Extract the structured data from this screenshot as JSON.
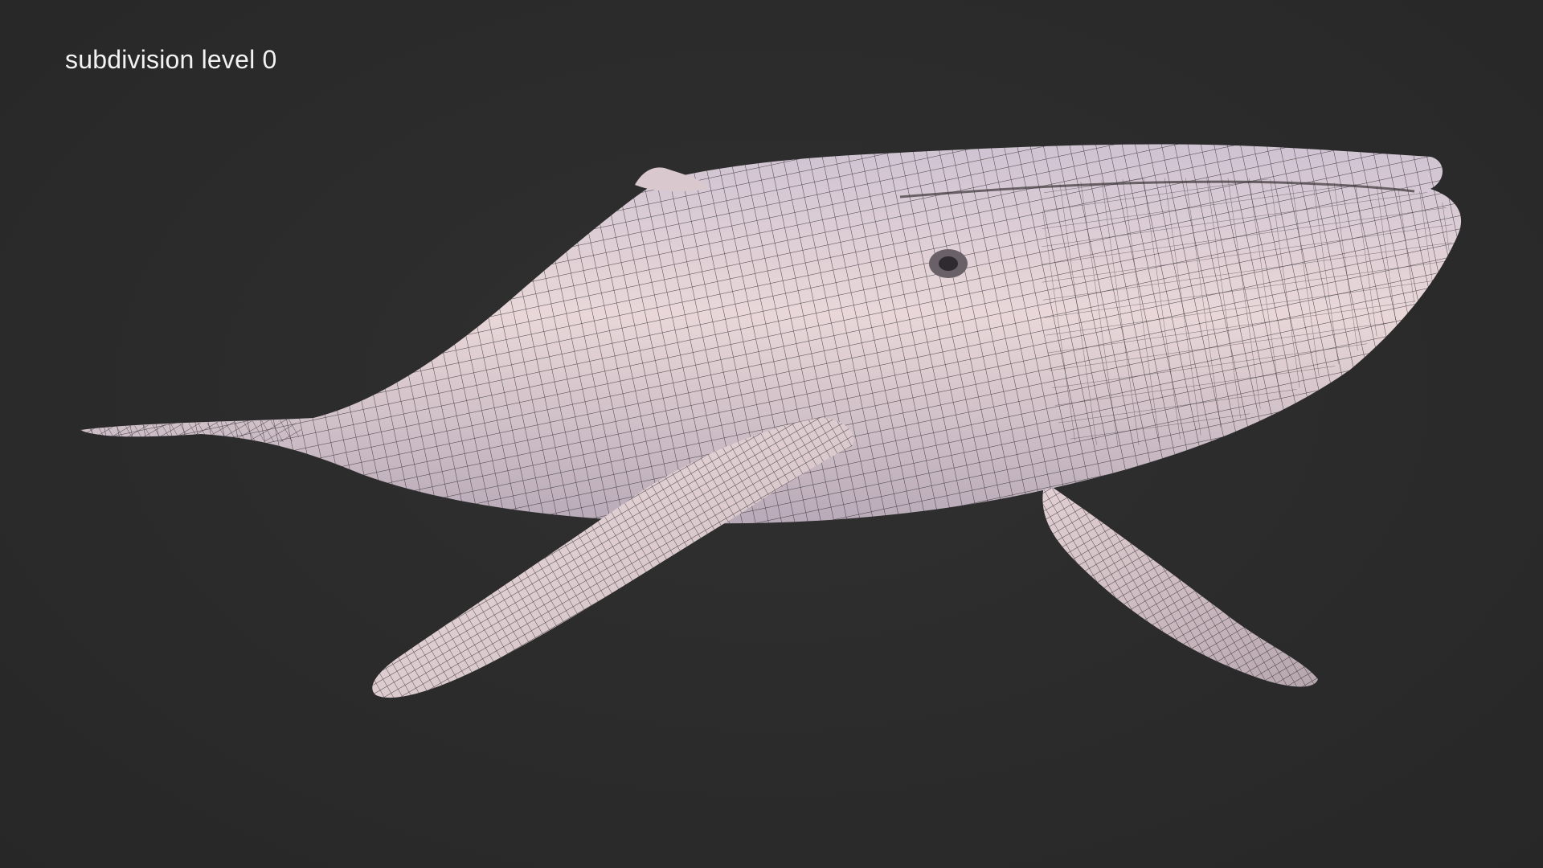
{
  "viewport": {
    "label": "subdivision level 0",
    "background_color": "#2b2b2b",
    "label_color": "#f2f2f2"
  },
  "model": {
    "subject": "humpback-whale",
    "display_mode": "wireframe-on-shaded",
    "surface_color": "#e6d2d4",
    "shadow_color": "#8e8898",
    "wire_color": "#2e2a2e"
  }
}
